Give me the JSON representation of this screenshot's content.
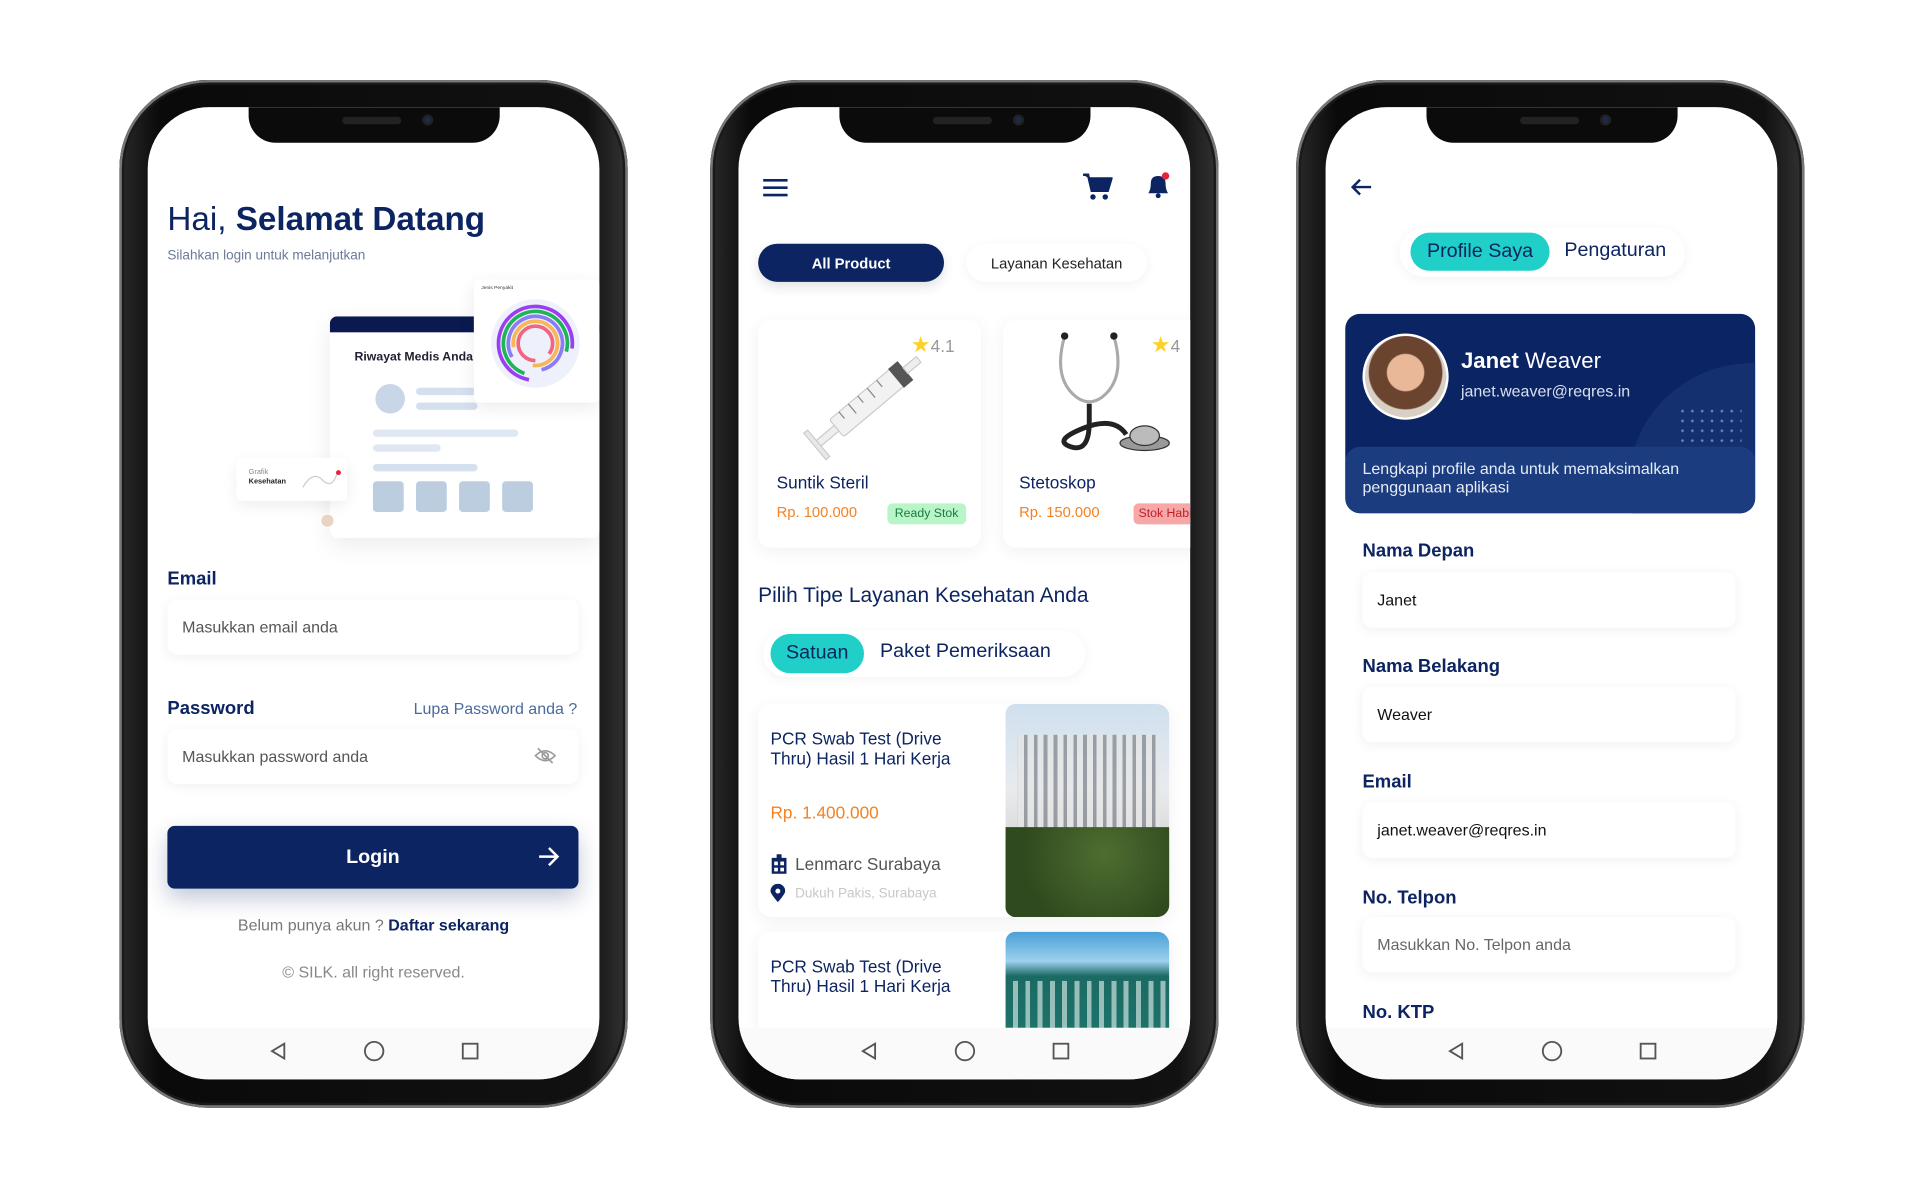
{
  "colors": {
    "navy": "#0c2461",
    "teal": "#20d0c8",
    "orange": "#f58220",
    "ready": "#b8f5c8",
    "sold_out": "#f6a8a8"
  },
  "login": {
    "greeting_regular": "Hai, ",
    "greeting_bold": "Selamat Datang",
    "subtitle": "Silahkan login untuk melanjutkan",
    "illustration": {
      "dashboard_title": "Riwayat Medis Anda",
      "chart_title": "Jenis Penyakit",
      "graph_label_1": "Grafik",
      "graph_label_2": "Kesehatan"
    },
    "email_label": "Email",
    "email_placeholder": "Masukkan email anda",
    "password_label": "Password",
    "forgot_password": "Lupa Password anda ?",
    "password_placeholder": "Masukkan password anda",
    "login_button": "Login",
    "no_account": "Belum punya akun ?",
    "register_link": "Daftar sekarang",
    "copyright": "© SILK. all right reserved."
  },
  "home": {
    "tabs": [
      {
        "label": "All Product",
        "active": true
      },
      {
        "label": "Layanan Kesehatan",
        "active": false
      }
    ],
    "products": [
      {
        "name": "Suntik Steril",
        "price": "Rp. 100.000",
        "rating": "4.1",
        "stock": "Ready Stok",
        "icon": "syringe"
      },
      {
        "name": "Stetoskop",
        "price": "Rp. 150.000",
        "rating": "4",
        "stock": "Stok Habis",
        "icon": "stethoscope"
      }
    ],
    "section_title": "Pilih Tipe Layanan Kesehatan Anda",
    "segments": [
      {
        "label": "Satuan",
        "active": true
      },
      {
        "label": "Paket Pemeriksaan",
        "active": false
      }
    ],
    "services": [
      {
        "title": "PCR Swab Test (Drive Thru) Hasil 1 Hari Kerja",
        "price": "Rp. 1.400.000",
        "hospital": "Lenmarc Surabaya",
        "address": "Dukuh Pakis, Surabaya"
      },
      {
        "title": "PCR Swab Test (Drive Thru) Hasil 1 Hari Kerja"
      }
    ]
  },
  "profile": {
    "tabs": [
      {
        "label": "Profile Saya",
        "active": true
      },
      {
        "label": "Pengaturan",
        "active": false
      }
    ],
    "first_name": "Janet",
    "last_name": "Weaver",
    "email": "janet.weaver@reqres.in",
    "prompt": "Lengkapi profile anda untuk memaksimalkan penggunaan aplikasi",
    "fields": [
      {
        "label": "Nama Depan",
        "value": "Janet"
      },
      {
        "label": "Nama Belakang",
        "value": "Weaver"
      },
      {
        "label": "Email",
        "value": "janet.weaver@reqres.in"
      },
      {
        "label": "No. Telpon",
        "placeholder": "Masukkan No. Telpon anda"
      },
      {
        "label": "No. KTP"
      }
    ]
  }
}
